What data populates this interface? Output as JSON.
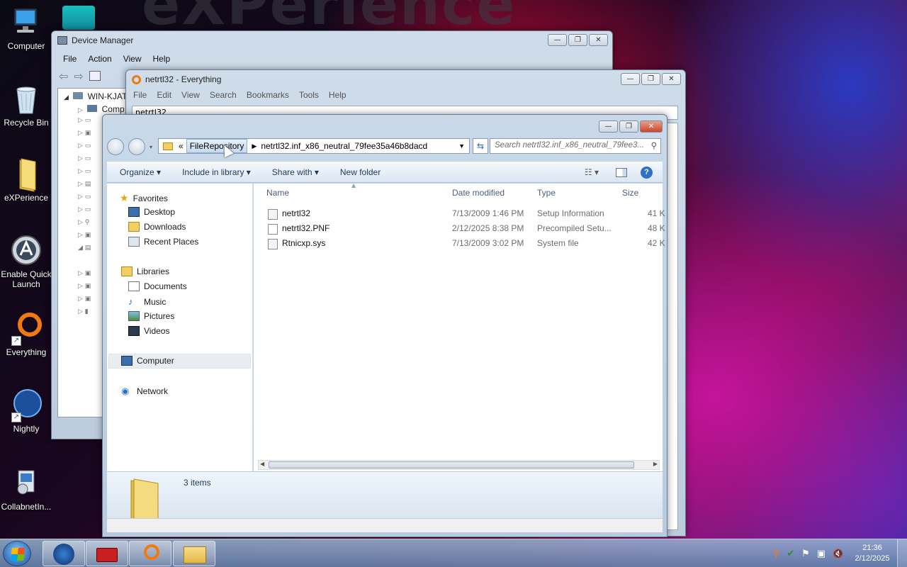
{
  "desktop": {
    "bg_text": "eXPerience",
    "icons": [
      {
        "label": "Computer"
      },
      {
        "label": "Recycle Bin"
      },
      {
        "label": "eXPerience"
      },
      {
        "label": "Enable Quick Launch"
      },
      {
        "label": "Everything"
      },
      {
        "label": "Nightly"
      },
      {
        "label": "CollabnetIn..."
      }
    ]
  },
  "device_manager": {
    "title": "Device Manager",
    "menu": [
      "File",
      "Action",
      "View",
      "Help"
    ],
    "tree_root": "WIN-KJAT",
    "tree_child": "Comp"
  },
  "everything": {
    "title": "netrtl32 - Everything",
    "menu": [
      "File",
      "Edit",
      "View",
      "Search",
      "Bookmarks",
      "Tools",
      "Help"
    ],
    "search_value": "netrtl32"
  },
  "explorer": {
    "address": {
      "overflow": "«",
      "crumb1": "FileRepository",
      "crumb2": "netrtl32.inf_x86_neutral_79fee35a46b8dacd"
    },
    "search_placeholder": "Search netrtl32.inf_x86_neutral_79fee3...",
    "toolbar": {
      "organize": "Organize",
      "include": "Include in library",
      "share": "Share with",
      "new_folder": "New folder"
    },
    "nav": {
      "favorites": "Favorites",
      "desktop": "Desktop",
      "downloads": "Downloads",
      "recent": "Recent Places",
      "libraries": "Libraries",
      "documents": "Documents",
      "music": "Music",
      "pictures": "Pictures",
      "videos": "Videos",
      "computer": "Computer",
      "network": "Network"
    },
    "columns": {
      "name": "Name",
      "date": "Date modified",
      "type": "Type",
      "size": "Size"
    },
    "files": [
      {
        "name": "netrtl32",
        "date": "7/13/2009 1:46 PM",
        "type": "Setup Information",
        "size": "41 K"
      },
      {
        "name": "netrtl32.PNF",
        "date": "2/12/2025 8:38 PM",
        "type": "Precompiled Setu...",
        "size": "48 K"
      },
      {
        "name": "Rtnicxp.sys",
        "date": "7/13/2009 3:02 PM",
        "type": "System file",
        "size": "42 K"
      }
    ],
    "details": {
      "count": "3 items"
    }
  },
  "taskbar": {
    "time": "21:36",
    "date": "2/12/2025"
  }
}
